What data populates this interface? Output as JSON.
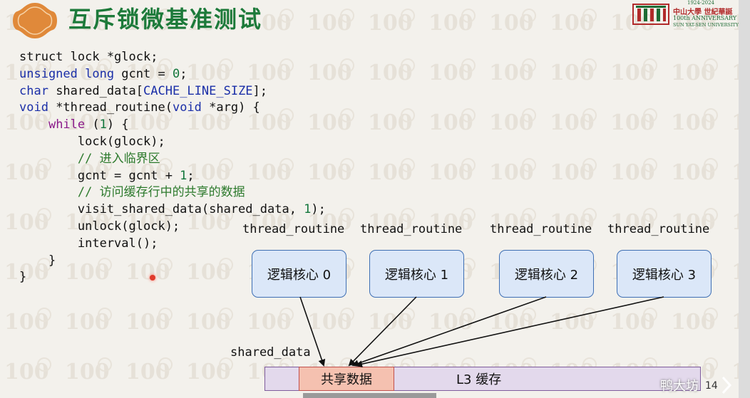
{
  "slide": {
    "title": "互斥锁微基准测试",
    "university": {
      "years": "1924-2024",
      "name_cn": "中山大學 世紀華誕",
      "anniversary": "100th ANNIVERSARY",
      "name_en": "SUN YAT-SEN UNIVERSITY"
    },
    "watermark_text": "100",
    "code_lines": [
      [
        {
          "t": "struct lock *glock;",
          "c": ""
        }
      ],
      [
        {
          "t": "unsigned long",
          "c": "kw"
        },
        {
          "t": " gcnt = ",
          "c": ""
        },
        {
          "t": "0",
          "c": "num"
        },
        {
          "t": ";",
          "c": ""
        }
      ],
      [
        {
          "t": "char",
          "c": "kw"
        },
        {
          "t": " shared_data[",
          "c": ""
        },
        {
          "t": "CACHE_LINE_SIZE",
          "c": "mac"
        },
        {
          "t": "];",
          "c": ""
        }
      ],
      [
        {
          "t": "void",
          "c": "kw"
        },
        {
          "t": " *thread_routine(",
          "c": ""
        },
        {
          "t": "void",
          "c": "kw"
        },
        {
          "t": " *arg) {",
          "c": ""
        }
      ],
      [
        {
          "t": "    ",
          "c": ""
        },
        {
          "t": "while",
          "c": "kw2"
        },
        {
          "t": " (",
          "c": ""
        },
        {
          "t": "1",
          "c": "num"
        },
        {
          "t": ") {",
          "c": ""
        }
      ],
      [
        {
          "t": "        lock(glock);",
          "c": ""
        }
      ],
      [
        {
          "t": "        // 进入临界区",
          "c": "cm"
        }
      ],
      [
        {
          "t": "        gcnt = gcnt + ",
          "c": ""
        },
        {
          "t": "1",
          "c": "num"
        },
        {
          "t": ";",
          "c": ""
        }
      ],
      [
        {
          "t": "        // 访问缓存行中的共享的数据",
          "c": "cm"
        }
      ],
      [
        {
          "t": "        visit_shared_data(shared_data, ",
          "c": ""
        },
        {
          "t": "1",
          "c": "num"
        },
        {
          "t": ");",
          "c": ""
        }
      ],
      [
        {
          "t": "        unlock(glock);",
          "c": ""
        }
      ],
      [
        {
          "t": "        interval();",
          "c": ""
        }
      ],
      [
        {
          "t": "    }",
          "c": ""
        }
      ],
      [
        {
          "t": "}",
          "c": ""
        }
      ]
    ],
    "thread_labels": [
      "thread_routine",
      "thread_routine",
      "thread_routine",
      "thread_routine"
    ],
    "cores": [
      "逻辑核心 0",
      "逻辑核心 1",
      "逻辑核心 2",
      "逻辑核心 3"
    ],
    "shared_data_label": "shared_data",
    "shared_block_label": "共享数据",
    "l3_label": "L3 缓存",
    "video_watermark": "鸭大坊",
    "page_number": "14"
  }
}
